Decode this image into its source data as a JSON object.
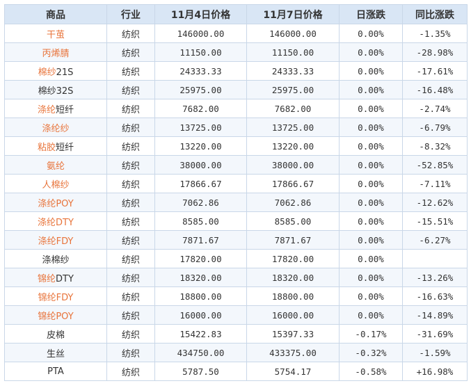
{
  "headers": [
    "商品",
    "行业",
    "11月4日价格",
    "11月7日价格",
    "日涨跌",
    "同比涨跌"
  ],
  "rows": [
    {
      "name_link": "干茧",
      "name_plain": "",
      "industry": "纺织",
      "price_nov4": "146000.00",
      "price_nov7": "146000.00",
      "daily_change": "0.00%",
      "daily_dir": "flat",
      "yoy_change": "-1.35%",
      "yoy_dir": "neg"
    },
    {
      "name_link": "丙烯腈",
      "name_plain": "",
      "industry": "纺织",
      "price_nov4": "11150.00",
      "price_nov7": "11150.00",
      "daily_change": "0.00%",
      "daily_dir": "flat",
      "yoy_change": "-28.98%",
      "yoy_dir": "neg"
    },
    {
      "name_link": "棉纱",
      "name_plain": "21S",
      "industry": "纺织",
      "price_nov4": "24333.33",
      "price_nov7": "24333.33",
      "daily_change": "0.00%",
      "daily_dir": "flat",
      "yoy_change": "-17.61%",
      "yoy_dir": "neg"
    },
    {
      "name_link": "",
      "name_plain": "棉纱32S",
      "industry": "纺织",
      "price_nov4": "25975.00",
      "price_nov7": "25975.00",
      "daily_change": "0.00%",
      "daily_dir": "flat",
      "yoy_change": "-16.48%",
      "yoy_dir": "neg"
    },
    {
      "name_link": "涤纶",
      "name_plain": "短纤",
      "industry": "纺织",
      "price_nov4": "7682.00",
      "price_nov7": "7682.00",
      "daily_change": "0.00%",
      "daily_dir": "flat",
      "yoy_change": "-2.74%",
      "yoy_dir": "neg"
    },
    {
      "name_link": "涤纶纱",
      "name_plain": "",
      "industry": "纺织",
      "price_nov4": "13725.00",
      "price_nov7": "13725.00",
      "daily_change": "0.00%",
      "daily_dir": "flat",
      "yoy_change": "-6.79%",
      "yoy_dir": "neg"
    },
    {
      "name_link": "粘胶",
      "name_plain": "短纤",
      "industry": "纺织",
      "price_nov4": "13220.00",
      "price_nov7": "13220.00",
      "daily_change": "0.00%",
      "daily_dir": "flat",
      "yoy_change": "-8.32%",
      "yoy_dir": "neg"
    },
    {
      "name_link": "氨纶",
      "name_plain": "",
      "industry": "纺织",
      "price_nov4": "38000.00",
      "price_nov7": "38000.00",
      "daily_change": "0.00%",
      "daily_dir": "flat",
      "yoy_change": "-52.85%",
      "yoy_dir": "neg"
    },
    {
      "name_link": "人棉纱",
      "name_plain": "",
      "industry": "纺织",
      "price_nov4": "17866.67",
      "price_nov7": "17866.67",
      "daily_change": "0.00%",
      "daily_dir": "flat",
      "yoy_change": "-7.11%",
      "yoy_dir": "neg"
    },
    {
      "name_link": "涤纶POY",
      "name_plain": "",
      "industry": "纺织",
      "price_nov4": "7062.86",
      "price_nov7": "7062.86",
      "daily_change": "0.00%",
      "daily_dir": "flat",
      "yoy_change": "-12.62%",
      "yoy_dir": "neg"
    },
    {
      "name_link": "涤纶DTY",
      "name_plain": "",
      "industry": "纺织",
      "price_nov4": "8585.00",
      "price_nov7": "8585.00",
      "daily_change": "0.00%",
      "daily_dir": "flat",
      "yoy_change": "-15.51%",
      "yoy_dir": "neg"
    },
    {
      "name_link": "涤纶FDY",
      "name_plain": "",
      "industry": "纺织",
      "price_nov4": "7871.67",
      "price_nov7": "7871.67",
      "daily_change": "0.00%",
      "daily_dir": "flat",
      "yoy_change": "-6.27%",
      "yoy_dir": "neg"
    },
    {
      "name_link": "",
      "name_plain": "涤棉纱",
      "industry": "纺织",
      "price_nov4": "17820.00",
      "price_nov7": "17820.00",
      "daily_change": "0.00%",
      "daily_dir": "flat",
      "yoy_change": "",
      "yoy_dir": "flat"
    },
    {
      "name_link": "锦纶",
      "name_plain": "DTY",
      "industry": "纺织",
      "price_nov4": "18320.00",
      "price_nov7": "18320.00",
      "daily_change": "0.00%",
      "daily_dir": "flat",
      "yoy_change": "-13.26%",
      "yoy_dir": "neg"
    },
    {
      "name_link": "锦纶FDY",
      "name_plain": "",
      "industry": "纺织",
      "price_nov4": "18800.00",
      "price_nov7": "18800.00",
      "daily_change": "0.00%",
      "daily_dir": "flat",
      "yoy_change": "-16.63%",
      "yoy_dir": "neg"
    },
    {
      "name_link": "锦纶POY",
      "name_plain": "",
      "industry": "纺织",
      "price_nov4": "16000.00",
      "price_nov7": "16000.00",
      "daily_change": "0.00%",
      "daily_dir": "flat",
      "yoy_change": "-14.89%",
      "yoy_dir": "neg"
    },
    {
      "name_link": "",
      "name_plain": "皮棉",
      "industry": "纺织",
      "price_nov4": "15422.83",
      "price_nov7": "15397.33",
      "daily_change": "-0.17%",
      "daily_dir": "neg",
      "yoy_change": "-31.69%",
      "yoy_dir": "neg"
    },
    {
      "name_link": "",
      "name_plain": "生丝",
      "industry": "纺织",
      "price_nov4": "434750.00",
      "price_nov7": "433375.00",
      "daily_change": "-0.32%",
      "daily_dir": "neg",
      "yoy_change": "-1.59%",
      "yoy_dir": "neg"
    },
    {
      "name_link": "",
      "name_plain": "PTA",
      "industry": "纺织",
      "price_nov4": "5787.50",
      "price_nov7": "5754.17",
      "daily_change": "-0.58%",
      "daily_dir": "neg",
      "yoy_change": "+16.98%",
      "yoy_dir": "pos"
    }
  ]
}
